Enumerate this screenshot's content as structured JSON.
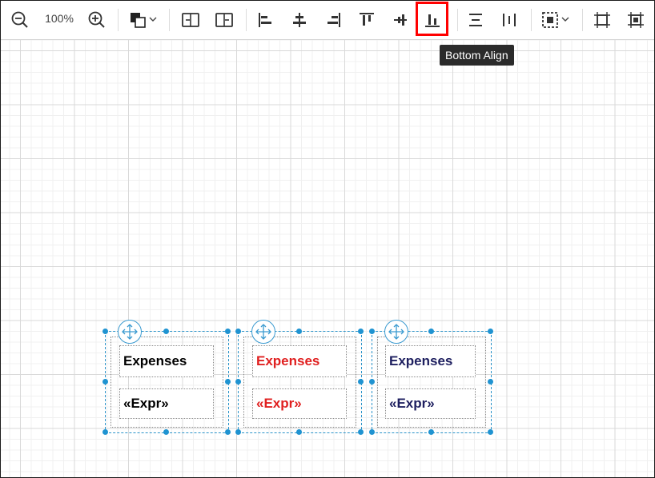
{
  "toolbar": {
    "zoom_level": "100%",
    "tooltip": "Bottom Align",
    "buttons": [
      {
        "name": "zoom-out",
        "icon": "zoom-out-icon"
      },
      {
        "name": "zoom-in",
        "icon": "zoom-in-icon"
      },
      {
        "name": "fill-color",
        "icon": "fill-color-icon"
      },
      {
        "name": "insert-left",
        "icon": "insert-left-icon"
      },
      {
        "name": "insert-right",
        "icon": "insert-right-icon"
      },
      {
        "name": "left-align",
        "icon": "align-left-icon"
      },
      {
        "name": "center-align",
        "icon": "align-center-icon"
      },
      {
        "name": "right-align",
        "icon": "align-right-icon"
      },
      {
        "name": "top-align",
        "icon": "align-top-icon"
      },
      {
        "name": "middle-align",
        "icon": "align-middle-icon"
      },
      {
        "name": "bottom-align",
        "icon": "align-bottom-icon",
        "active": true
      },
      {
        "name": "distribute-horizontal",
        "icon": "distribute-horizontal-icon"
      },
      {
        "name": "distribute-vertical",
        "icon": "distribute-vertical-icon"
      },
      {
        "name": "select",
        "icon": "select-icon"
      },
      {
        "name": "crop",
        "icon": "crop-icon"
      },
      {
        "name": "fit",
        "icon": "fit-icon"
      }
    ]
  },
  "canvas": {
    "groups": [
      {
        "title": "Expenses",
        "expr": "«Expr»",
        "color": "#000000"
      },
      {
        "title": "Expenses",
        "expr": "«Expr»",
        "color": "#e02020"
      },
      {
        "title": "Expenses",
        "expr": "«Expr»",
        "color": "#1f2060"
      }
    ]
  },
  "colors": {
    "accent": "#1f93d1",
    "highlight": "#ff0000",
    "tooltip_bg": "#2b2b2b"
  }
}
